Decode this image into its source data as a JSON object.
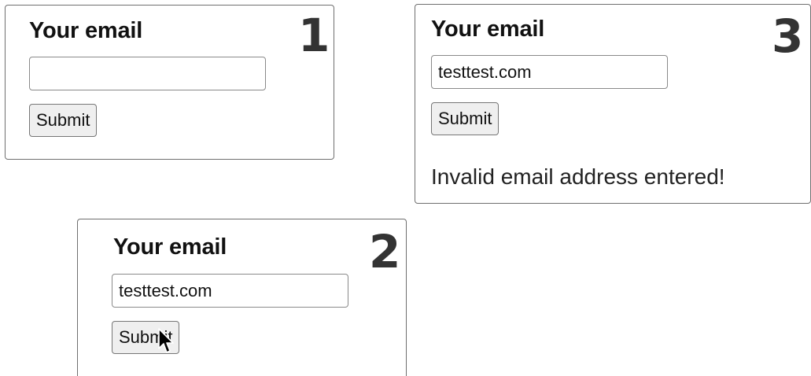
{
  "panels": [
    {
      "step": "1",
      "heading": "Your email",
      "email_value": "",
      "submit_label": "Submit"
    },
    {
      "step": "2",
      "heading": "Your email",
      "email_value": "testtest.com",
      "submit_label": "Submit"
    },
    {
      "step": "3",
      "heading": "Your email",
      "email_value": "testtest.com",
      "submit_label": "Submit",
      "error_message": "Invalid email address entered!"
    }
  ],
  "icons": {
    "cursor": "mouse-pointer-arrow"
  },
  "colors": {
    "panel_border": "#6f6f6f",
    "step_number": "#333333",
    "button_background": "#efefef"
  }
}
